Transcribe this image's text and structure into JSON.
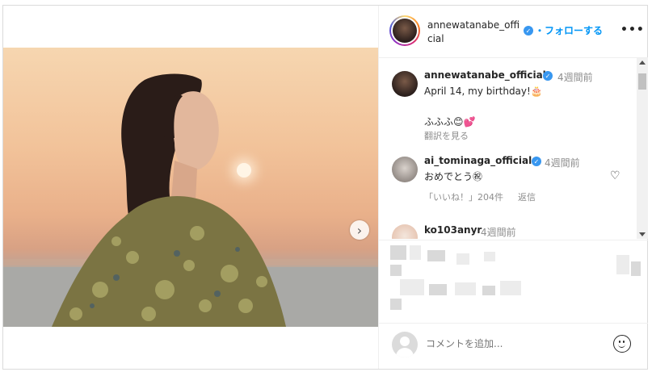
{
  "header": {
    "username": "annewatanabe_official",
    "follow_sep": "・",
    "follow_label": "フォローする",
    "more_label": "•••"
  },
  "comments": [
    {
      "username": "annewatanabe_official",
      "time": "4週間前",
      "lines": [
        "April 14, my birthday!🎂",
        "ふふふ😊💕"
      ],
      "translate": "翻訳を見る"
    },
    {
      "username": "ai_tominaga_official",
      "time": "4週間前",
      "text": "おめでとう㊗",
      "likes": "「いいね！」204件",
      "reply": "返信"
    },
    {
      "username": "ko103anyr",
      "time": "4週間前"
    }
  ],
  "composer": {
    "placeholder": "コメントを追加..."
  },
  "icons": {
    "verified": "verified-badge-icon",
    "heart": "heart-icon",
    "next": "chevron-right-icon",
    "emoji": "emoji-icon"
  },
  "colors": {
    "link": "#0095f6",
    "verified": "#3897f0",
    "secondary_text": "#8e8e8e",
    "carousel_active_dot": "#1e88e5"
  }
}
